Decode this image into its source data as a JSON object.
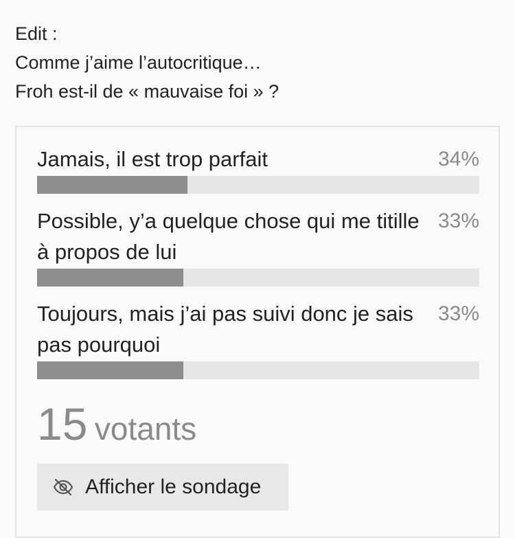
{
  "post": {
    "lines": [
      "Edit :",
      "Comme j’aime l’autocritique…",
      "Froh est-il de « mauvaise foi » ?"
    ]
  },
  "poll": {
    "options": [
      {
        "label": "Jamais, il est trop parfait",
        "percent_text": "34%",
        "percent": 34
      },
      {
        "label": "Possible, y’a quelque chose qui me titille à propos de lui",
        "percent_text": "33%",
        "percent": 33
      },
      {
        "label": "Toujours, mais j’ai pas suivi donc je sais pas pourquoi",
        "percent_text": "33%",
        "percent": 33
      }
    ],
    "voters": {
      "count": "15",
      "label": "votants"
    },
    "show_button": {
      "label": "Afficher le sondage",
      "icon": "eye-off-icon"
    },
    "colors": {
      "bar_fill": "#8e8e8e",
      "bar_track": "#e6e6e6",
      "button_bg": "#e8e8e8",
      "muted_text": "#8a8a8a"
    }
  }
}
